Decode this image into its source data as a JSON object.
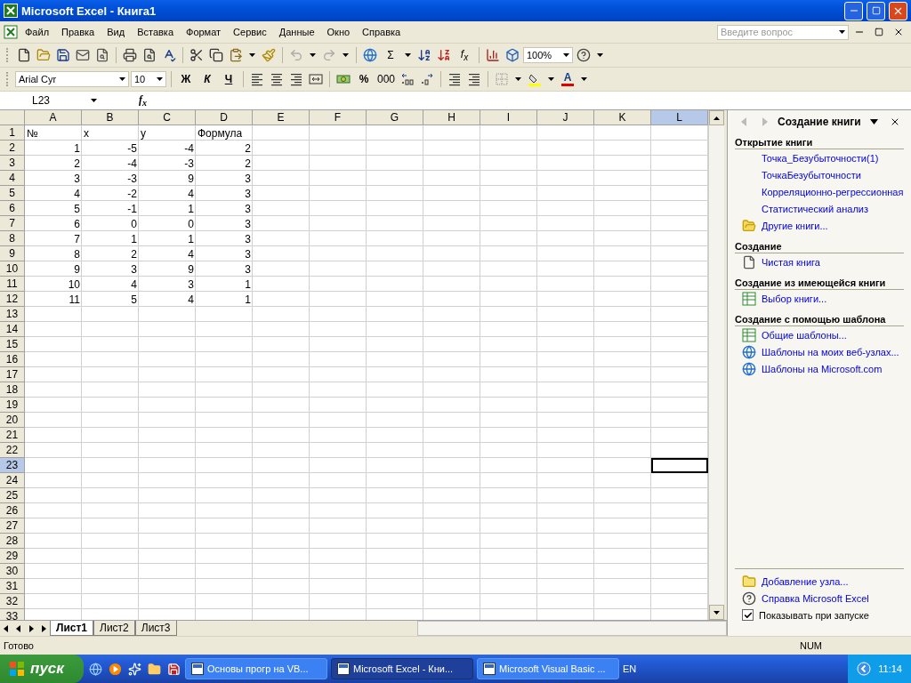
{
  "window": {
    "title": "Microsoft Excel - Книга1"
  },
  "menu": [
    "Файл",
    "Правка",
    "Вид",
    "Вставка",
    "Формат",
    "Сервис",
    "Данные",
    "Окно",
    "Справка"
  ],
  "help_box": {
    "placeholder": "Введите вопрос"
  },
  "standard_toolbar": {
    "sum": "Σ",
    "insert_function": "f$_{x}$",
    "zoom": "100%"
  },
  "formatting_toolbar": {
    "font": "Arial Cyr",
    "size": "10",
    "bold": "Ж",
    "italic": "К",
    "underline": "Ч",
    "percent": "%",
    "thousands": "000",
    "font_color": "A"
  },
  "formula_bar": {
    "name_box": "L23",
    "function_label": "f$_{x}$"
  },
  "columns": [
    {
      "label": "A",
      "selected": false
    },
    {
      "label": "B",
      "selected": false
    },
    {
      "label": "C",
      "selected": false
    },
    {
      "label": "D",
      "selected": false
    },
    {
      "label": "E",
      "selected": false
    },
    {
      "label": "F",
      "selected": false
    },
    {
      "label": "G",
      "selected": false
    },
    {
      "label": "H",
      "selected": false
    },
    {
      "label": "I",
      "selected": false
    },
    {
      "label": "J",
      "selected": false
    },
    {
      "label": "K",
      "selected": false
    },
    {
      "label": "L",
      "selected": true
    }
  ],
  "rows": [
    {
      "number": "1",
      "selected": false,
      "kind": "text",
      "cells": [
        "№",
        "x",
        "y",
        "Формула"
      ]
    },
    {
      "number": "2",
      "selected": false,
      "kind": "number",
      "cells": [
        "1",
        "-5",
        "-4",
        "2"
      ]
    },
    {
      "number": "3",
      "selected": false,
      "kind": "number",
      "cells": [
        "2",
        "-4",
        "-3",
        "2"
      ]
    },
    {
      "number": "4",
      "selected": false,
      "kind": "number",
      "cells": [
        "3",
        "-3",
        "9",
        "3"
      ]
    },
    {
      "number": "5",
      "selected": false,
      "kind": "number",
      "cells": [
        "4",
        "-2",
        "4",
        "3"
      ]
    },
    {
      "number": "6",
      "selected": false,
      "kind": "number",
      "cells": [
        "5",
        "-1",
        "1",
        "3"
      ]
    },
    {
      "number": "7",
      "selected": false,
      "kind": "number",
      "cells": [
        "6",
        "0",
        "0",
        "3"
      ]
    },
    {
      "number": "8",
      "selected": false,
      "kind": "number",
      "cells": [
        "7",
        "1",
        "1",
        "3"
      ]
    },
    {
      "number": "9",
      "selected": false,
      "kind": "number",
      "cells": [
        "8",
        "2",
        "4",
        "3"
      ]
    },
    {
      "number": "10",
      "selected": false,
      "kind": "number",
      "cells": [
        "9",
        "3",
        "9",
        "3"
      ]
    },
    {
      "number": "11",
      "selected": false,
      "kind": "number",
      "cells": [
        "10",
        "4",
        "3",
        "1"
      ]
    },
    {
      "number": "12",
      "selected": false,
      "kind": "number",
      "cells": [
        "11",
        "5",
        "4",
        "1"
      ]
    },
    {
      "number": "13",
      "selected": false
    },
    {
      "number": "14",
      "selected": false
    },
    {
      "number": "15",
      "selected": false
    },
    {
      "number": "16",
      "selected": false
    },
    {
      "number": "17",
      "selected": false
    },
    {
      "number": "18",
      "selected": false
    },
    {
      "number": "19",
      "selected": false
    },
    {
      "number": "20",
      "selected": false
    },
    {
      "number": "21",
      "selected": false
    },
    {
      "number": "22",
      "selected": false
    },
    {
      "number": "23",
      "selected": true
    },
    {
      "number": "24",
      "selected": false
    },
    {
      "number": "25",
      "selected": false
    },
    {
      "number": "26",
      "selected": false
    },
    {
      "number": "27",
      "selected": false
    },
    {
      "number": "28",
      "selected": false
    },
    {
      "number": "29",
      "selected": false
    },
    {
      "number": "30",
      "selected": false
    },
    {
      "number": "31",
      "selected": false
    },
    {
      "number": "32",
      "selected": false
    },
    {
      "number": "33",
      "selected": false
    }
  ],
  "sheet_tabs": [
    {
      "label": "Лист1",
      "selected": true
    },
    {
      "label": "Лист2",
      "selected": false
    },
    {
      "label": "Лист3",
      "selected": false
    }
  ],
  "task_pane": {
    "title": "Создание книги",
    "sections": [
      {
        "heading": "Открытие книги",
        "items": [
          {
            "label": "Точка_Безубыточности(1)",
            "kind": "recent"
          },
          {
            "label": "ТочкаБезубыточности",
            "kind": "recent"
          },
          {
            "label": "Корреляционно-регрессионная",
            "kind": "recent"
          },
          {
            "label": "Статистический анализ",
            "kind": "recent"
          },
          {
            "label": "Другие книги...",
            "kind": "folder"
          }
        ]
      },
      {
        "heading": "Создание",
        "items": [
          {
            "label": "Чистая книга",
            "kind": "blank"
          }
        ]
      },
      {
        "heading": "Создание из имеющейся книги",
        "items": [
          {
            "label": "Выбор книги...",
            "kind": "workbook"
          }
        ]
      },
      {
        "heading": "Создание с помощью шаблона",
        "items": [
          {
            "label": "Общие шаблоны...",
            "kind": "workbook"
          },
          {
            "label": "Шаблоны на моих веб-узлах...",
            "kind": "web"
          },
          {
            "label": "Шаблоны на Microsoft.com",
            "kind": "web"
          }
        ]
      }
    ],
    "footer_links": [
      {
        "label": "Добавление узла...",
        "kind": "add-site"
      },
      {
        "label": "Справка Microsoft Excel",
        "kind": "help"
      }
    ],
    "show_at_startup": {
      "label": "Показывать при запуске",
      "checked": true
    }
  },
  "status_bar": {
    "text": "Готово",
    "indicator": "NUM"
  },
  "taskbar": {
    "start": "пуск",
    "tasks": [
      {
        "label": "Основы прогр на VB...",
        "selected": false
      },
      {
        "label": "Microsoft Excel - Кни...",
        "selected": true
      },
      {
        "label": "Microsoft Visual Basic ...",
        "selected": false
      }
    ],
    "language": "EN",
    "clock": "11:14"
  }
}
